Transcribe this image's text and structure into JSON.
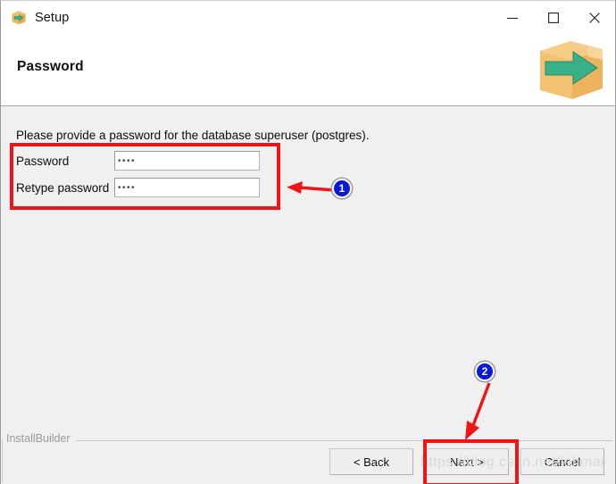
{
  "window": {
    "title": "Setup",
    "app_icon": "package-arrow-icon",
    "controls": {
      "minimize": "minimize-icon",
      "maximize": "maximize-icon",
      "close": "close-icon"
    }
  },
  "header": {
    "page_title": "Password",
    "logo_icon": "package-arrow-logo"
  },
  "main": {
    "intro_text": "Please provide a password for the database superuser (postgres).",
    "fields": [
      {
        "label": "Password",
        "name": "password-input",
        "value": "xxxx",
        "masked": true,
        "placeholder": ""
      },
      {
        "label": "Retype password",
        "name": "retype-password-input",
        "value": "xxxx",
        "masked": true,
        "placeholder": ""
      }
    ]
  },
  "footer": {
    "brand": "InstallBuilder",
    "buttons": [
      {
        "label": "< Back",
        "name": "back-button"
      },
      {
        "label": "Next >",
        "name": "next-button"
      },
      {
        "label": "Cancel",
        "name": "cancel-button"
      }
    ]
  },
  "watermark": {
    "text": "https://blog.csdn.net/lehmar"
  },
  "annotations": {
    "badges": [
      {
        "number": "1",
        "target": "password-fields"
      },
      {
        "number": "2",
        "target": "next-button"
      }
    ],
    "highlight_color": "#f01515",
    "badge_color": "#0a18d8"
  }
}
